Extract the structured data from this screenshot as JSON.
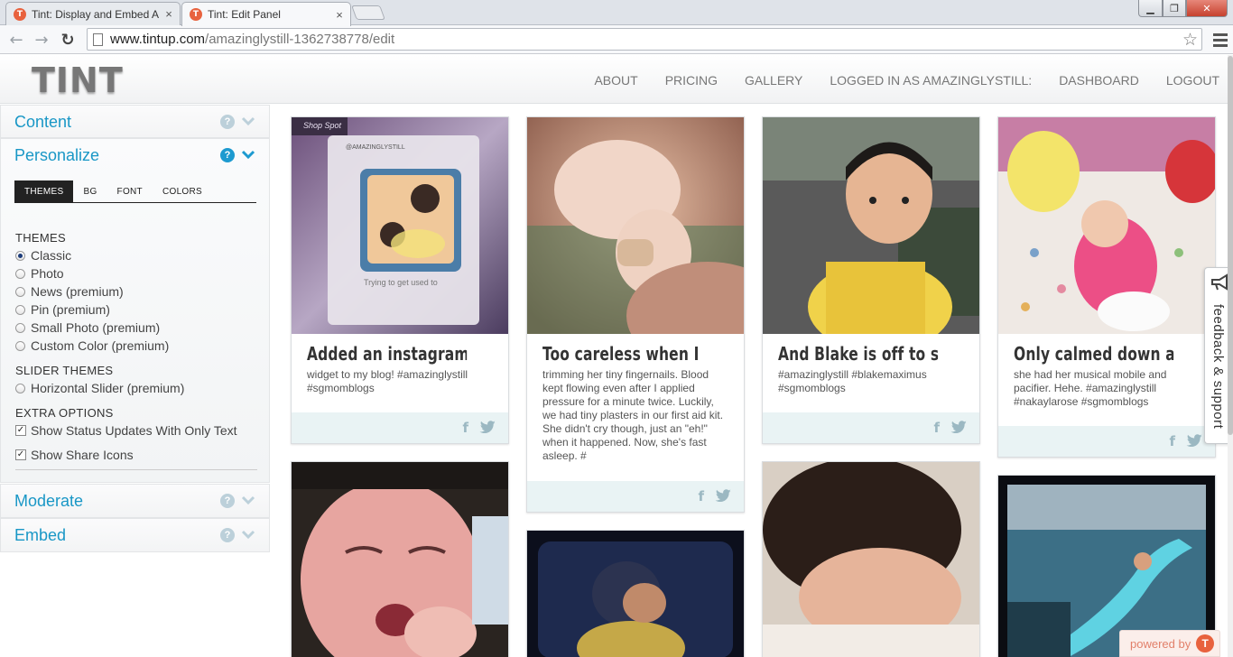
{
  "browser": {
    "tabs": [
      {
        "title": "Tint: Display and Embed A",
        "active": false
      },
      {
        "title": "Tint: Edit Panel",
        "active": true
      }
    ],
    "favicon_letter": "T",
    "close_glyph": "×",
    "url_host": "www.tintup.com",
    "url_path": "/amazinglystill-1362738778/edit",
    "window_controls": {
      "minimize": "▁",
      "maximize": "❐",
      "close": "✕"
    }
  },
  "site": {
    "logo": "TINT",
    "nav": [
      "ABOUT",
      "PRICING",
      "GALLERY",
      "LOGGED IN AS AMAZINGLYSTILL:",
      "DASHBOARD",
      "LOGOUT"
    ]
  },
  "sidebar": {
    "sections": {
      "content": "Content",
      "personalize": "Personalize",
      "moderate": "Moderate",
      "embed": "Embed"
    },
    "help_glyph": "?",
    "personalize_tabs": [
      "THEMES",
      "BG",
      "FONT",
      "COLORS"
    ],
    "themes_heading": "THEMES",
    "themes": [
      {
        "label": "Classic",
        "selected": true
      },
      {
        "label": "Photo",
        "selected": false
      },
      {
        "label": "News (premium)",
        "selected": false
      },
      {
        "label": "Pin (premium)",
        "selected": false
      },
      {
        "label": "Small Photo (premium)",
        "selected": false
      },
      {
        "label": "Custom Color (premium)",
        "selected": false
      }
    ],
    "slider_heading": "SLIDER THEMES",
    "slider_themes": [
      {
        "label": "Horizontal Slider (premium)",
        "selected": false
      }
    ],
    "extra_heading": "EXTRA OPTIONS",
    "extra_options": [
      {
        "label": "Show Status Updates With Only Text",
        "checked": true
      },
      {
        "label": "Show Share Icons",
        "checked": true
      }
    ],
    "check_glyph": "✓"
  },
  "feed": {
    "posts": [
      {
        "title": "Added an instagram",
        "text": "widget to my blog! #amazinglystill #sgmomblogs"
      },
      {
        "title": "Too careless when I was",
        "text": "trimming her tiny fingernails. Blood kept flowing even after I applied pressure for a minute twice. Luckily, we had tiny plasters in our first aid kit. She didn't cry though, just an \"eh!\" when it happened. Now, she's fast asleep. #"
      },
      {
        "title": "And Blake is off to school!",
        "text": "#amazinglystill #blakemaximus #sgmomblogs"
      },
      {
        "title": "Only calmed down after",
        "text": "she had her musical mobile and pacifier. Hehe. #amazinglystill #nakaylarose #sgmomblogs"
      }
    ],
    "share_fb_glyph": "f",
    "photo1_overlay": {
      "tag": "Shop Spot",
      "handle": "@AMAZINGLYSTILL",
      "caption": "Trying to get used to"
    }
  },
  "feedback_label": "feedback & support",
  "powered_by": "powered by",
  "powered_icon": "T",
  "colors": {
    "accent": "#1997c6",
    "brand": "#e8623e"
  }
}
